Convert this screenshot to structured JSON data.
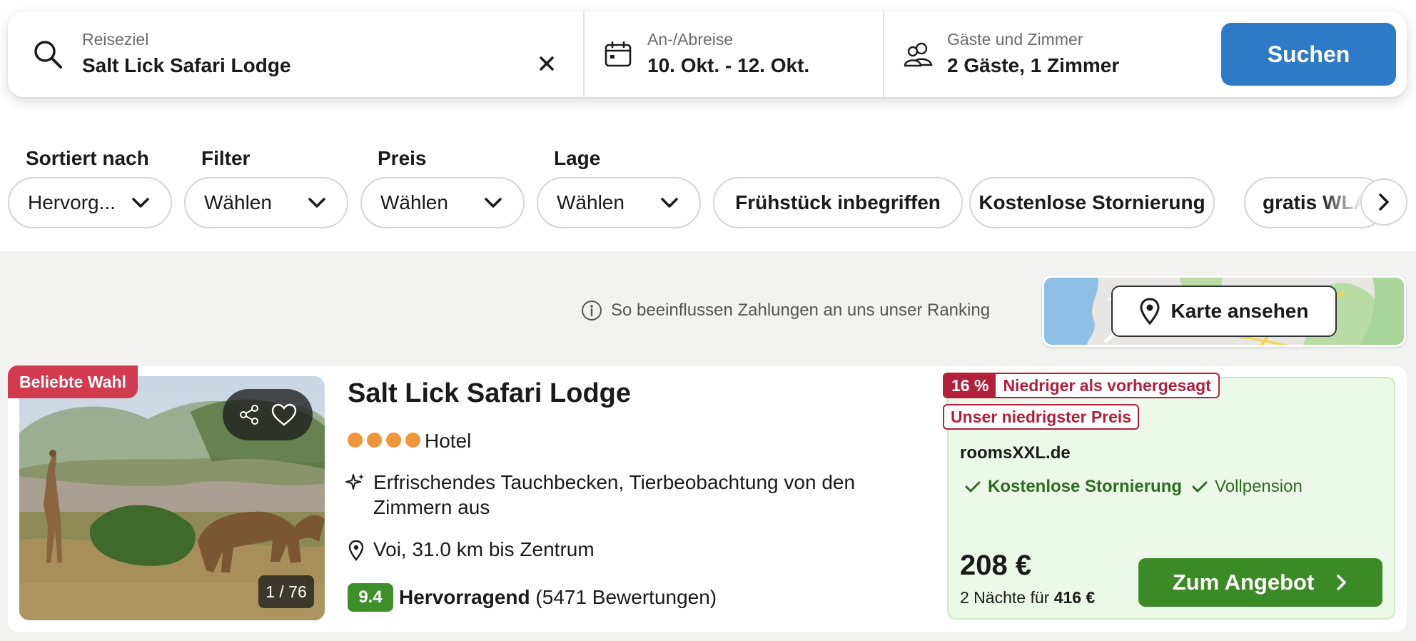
{
  "search": {
    "destination_label": "Reiseziel",
    "destination_value": "Salt Lick Safari Lodge",
    "dates_label": "An-/Abreise",
    "dates_value": "10. Okt. - 12. Okt.",
    "guests_label": "Gäste und Zimmer",
    "guests_value": "2 Gäste, 1 Zimmer",
    "search_button": "Suchen"
  },
  "filters": {
    "sort_label": "Sortiert nach",
    "sort_value": "Hervorg...",
    "filter_label": "Filter",
    "filter_value": "Wählen",
    "price_label": "Preis",
    "price_value": "Wählen",
    "location_label": "Lage",
    "location_value": "Wählen",
    "quick_filters": [
      "Frühstück inbegriffen",
      "Kostenlose Stornierung",
      "gratis WLAN"
    ]
  },
  "ranking_info": "So beeinflussen Zahlungen an uns unser Ranking",
  "map_button": "Karte ansehen",
  "result": {
    "badge": "Beliebte Wahl",
    "photo_counter": "1 / 76",
    "name": "Salt Lick Safari Lodge",
    "stars": 4,
    "type": "Hotel",
    "feature": "Erfrischendes Tauchbecken, Tierbeobachtung von den Zimmern aus",
    "location": "Voi, 31.0 km bis Zentrum",
    "score": "9.4",
    "rating_word": "Hervorragend",
    "reviews": "(5471 Bewertungen)",
    "deal": {
      "percent": "16 %",
      "percent_text": "Niedriger als vorhergesagt",
      "lowest_price": "Unser niedrigster Preis",
      "provider": "roomsXXL.de",
      "perk_1": "Kostenlose Stornierung",
      "perk_2": "Vollpension",
      "price": "208 €",
      "nights_text": "2 Nächte für",
      "nights_total": "416 €",
      "cta": "Zum Angebot"
    }
  },
  "colors": {
    "search_button": "#2f7ac6",
    "badge_red": "#d23a4f",
    "deal_red": "#b3203a",
    "score_green": "#3e8f2a",
    "cta_green": "#3b8a26",
    "star_orange": "#f0963a"
  }
}
